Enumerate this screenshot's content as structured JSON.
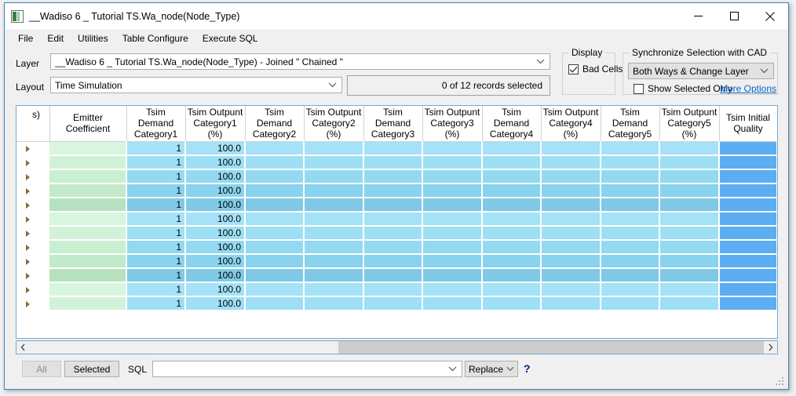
{
  "window": {
    "title": "__Wadiso 6 _ Tutorial TS.Wa_node(Node_Type)",
    "icon": "app-icon",
    "minimize_label": "Minimize",
    "maximize_label": "Maximize",
    "close_label": "Close"
  },
  "menubar": {
    "items": [
      {
        "label": "File"
      },
      {
        "label": "Edit"
      },
      {
        "label": "Utilities"
      },
      {
        "label": "Table Configure"
      },
      {
        "label": "Execute SQL"
      }
    ]
  },
  "layer": {
    "label": "Layer",
    "value": "__Wadiso 6 _ Tutorial TS.Wa_node(Node_Type) - Joined \" Chained \""
  },
  "layout": {
    "label": "Layout",
    "value": "Time Simulation"
  },
  "records": {
    "status": "0 of 12 records selected"
  },
  "display_group": {
    "title": "Display",
    "bad_cells_label": "Bad Cells",
    "bad_cells_checked": true
  },
  "sync_group": {
    "title": "Synchronize Selection with CAD",
    "mode_value": "Both Ways & Change Layer",
    "show_selected_only_label": "Show Selected Only",
    "show_selected_only_checked": false,
    "more_options_label": "More Options"
  },
  "grid": {
    "columns": [
      {
        "key": "rowsel",
        "header": "",
        "width": 20
      },
      {
        "key": "cutoff",
        "header": "s)",
        "width": 22
      },
      {
        "key": "emitter",
        "header": "Emitter\nCoefficient",
        "width": 98
      },
      {
        "key": "td1",
        "header": "Tsim Demand\nCategory1",
        "width": 75
      },
      {
        "key": "to1",
        "header": "Tsim Outpunt\nCategory1 (%)",
        "width": 76
      },
      {
        "key": "td2",
        "header": "Tsim Demand\nCategory2",
        "width": 75
      },
      {
        "key": "to2",
        "header": "Tsim Outpunt\nCategory2 (%)",
        "width": 76
      },
      {
        "key": "td3",
        "header": "Tsim Demand\nCategory3",
        "width": 75
      },
      {
        "key": "to3",
        "header": "Tsim Outpunt\nCategory3 (%)",
        "width": 76
      },
      {
        "key": "td4",
        "header": "Tsim Demand\nCategory4",
        "width": 75
      },
      {
        "key": "to4",
        "header": "Tsim Outpunt\nCategory4 (%)",
        "width": 76
      },
      {
        "key": "td5",
        "header": "Tsim Demand\nCategory5",
        "width": 75
      },
      {
        "key": "to5",
        "header": "Tsim Outpunt\nCategory5 (%)",
        "width": 76
      },
      {
        "key": "tiq",
        "header": "Tsim Initial\nQuality",
        "width": 74
      },
      {
        "key": "pad",
        "header": "",
        "width": 32
      }
    ],
    "row_count": 12,
    "rows": [
      {
        "emitter": "",
        "td1": "1",
        "to1": "100.0",
        "td2": "",
        "to2": "",
        "td3": "",
        "to3": "",
        "td4": "",
        "to4": "",
        "td5": "",
        "to5": "",
        "tiq": ""
      },
      {
        "emitter": "",
        "td1": "1",
        "to1": "100.0",
        "td2": "",
        "to2": "",
        "td3": "",
        "to3": "",
        "td4": "",
        "to4": "",
        "td5": "",
        "to5": "",
        "tiq": ""
      },
      {
        "emitter": "",
        "td1": "1",
        "to1": "100.0",
        "td2": "",
        "to2": "",
        "td3": "",
        "to3": "",
        "td4": "",
        "to4": "",
        "td5": "",
        "to5": "",
        "tiq": ""
      },
      {
        "emitter": "",
        "td1": "1",
        "to1": "100.0",
        "td2": "",
        "to2": "",
        "td3": "",
        "to3": "",
        "td4": "",
        "to4": "",
        "td5": "",
        "to5": "",
        "tiq": ""
      },
      {
        "emitter": "",
        "td1": "1",
        "to1": "100.0",
        "td2": "",
        "to2": "",
        "td3": "",
        "to3": "",
        "td4": "",
        "to4": "",
        "td5": "",
        "to5": "",
        "tiq": ""
      },
      {
        "emitter": "",
        "td1": "1",
        "to1": "100.0",
        "td2": "",
        "to2": "",
        "td3": "",
        "to3": "",
        "td4": "",
        "to4": "",
        "td5": "",
        "to5": "",
        "tiq": ""
      },
      {
        "emitter": "",
        "td1": "1",
        "to1": "100.0",
        "td2": "",
        "to2": "",
        "td3": "",
        "to3": "",
        "td4": "",
        "to4": "",
        "td5": "",
        "to5": "",
        "tiq": ""
      },
      {
        "emitter": "",
        "td1": "1",
        "to1": "100.0",
        "td2": "",
        "to2": "",
        "td3": "",
        "to3": "",
        "td4": "",
        "to4": "",
        "td5": "",
        "to5": "",
        "tiq": ""
      },
      {
        "emitter": "",
        "td1": "1",
        "to1": "100.0",
        "td2": "",
        "to2": "",
        "td3": "",
        "to3": "",
        "td4": "",
        "to4": "",
        "td5": "",
        "to5": "",
        "tiq": ""
      },
      {
        "emitter": "",
        "td1": "1",
        "to1": "100.0",
        "td2": "",
        "to2": "",
        "td3": "",
        "to3": "",
        "td4": "",
        "to4": "",
        "td5": "",
        "to5": "",
        "tiq": ""
      },
      {
        "emitter": "",
        "td1": "1",
        "to1": "100.0",
        "td2": "",
        "to2": "",
        "td3": "",
        "to3": "",
        "td4": "",
        "to4": "",
        "td5": "",
        "to5": "",
        "tiq": ""
      },
      {
        "emitter": "",
        "td1": "1",
        "to1": "100.0",
        "td2": "",
        "to2": "",
        "td3": "",
        "to3": "",
        "td4": "",
        "to4": "",
        "td5": "",
        "to5": "",
        "tiq": ""
      }
    ]
  },
  "colors": {
    "green_cell": "#d2f2d8",
    "blue_cell": "#9ddff5",
    "blue_key_cell": "#5cadf2",
    "accent_border": "#3f80c0",
    "link": "#0066cc"
  },
  "scrollbar": {
    "left_arrow": "scroll-left-icon",
    "right_arrow": "scroll-right-icon"
  },
  "bottombar": {
    "all_label": "All",
    "all_enabled": false,
    "selected_label": "Selected",
    "sql_label": "SQL",
    "sql_value": "",
    "replace_value": "Replace",
    "help_label": "?"
  }
}
